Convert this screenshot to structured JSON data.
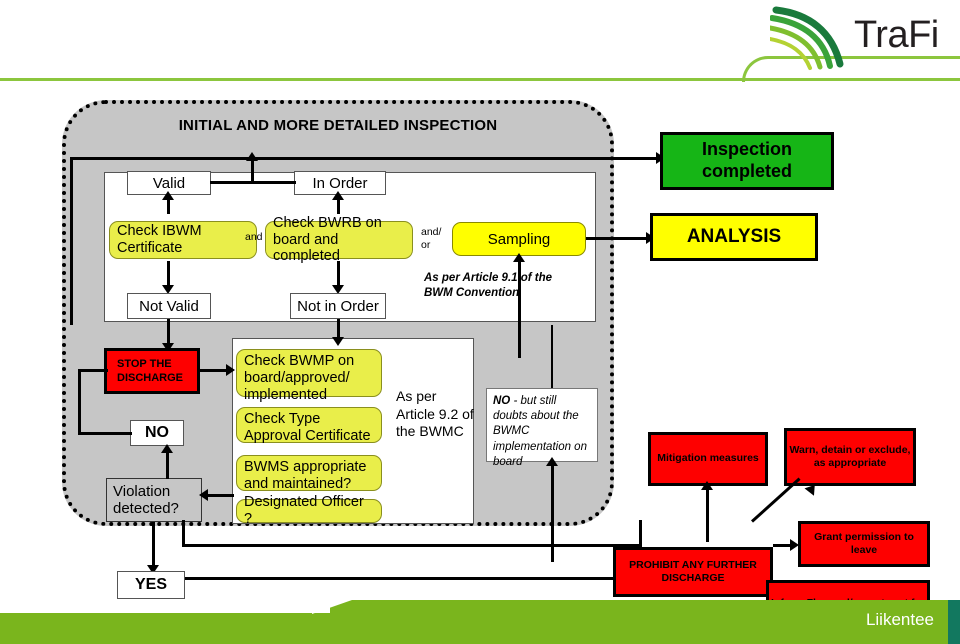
{
  "brand": {
    "logo_text": "TraFi",
    "logo_icon": "trafi-swoosh-logo",
    "accent_green": "#8cc63e",
    "accent_teal": "#12785f"
  },
  "footer": {
    "text": "Liikentee",
    "band_color": "#7ab51d"
  },
  "zone": {
    "title": "INITIAL AND MORE DETAILED INSPECTION",
    "fill": "#c6c6c6"
  },
  "top_flow": {
    "valid": "Valid",
    "in_order": "In Order",
    "not_valid_prefix": "Not ",
    "not_valid": "Not Valid",
    "not_in_order": "Not in Order",
    "check_ibwm": "Check IBWM Certificate",
    "check_bwrb": "Check BWRB on board and completed",
    "sampling": "Sampling",
    "conn_and": "and",
    "conn_and_or_line1": "and/",
    "conn_and_or_line2": "or",
    "article_note": "As per Article 9.1 of the BWM Convention"
  },
  "outcomes": {
    "inspection_completed": "Inspection completed",
    "analysis": "ANALYSIS"
  },
  "lower_flow": {
    "stop_discharge": "STOP THE DISCHARGE",
    "no": "NO",
    "yes": "YES",
    "violation_detected": "Violation detected?",
    "check_bwmp": "Check BWMP on board/approved/ implemented",
    "check_type_approval": "Check Type Approval Certificate",
    "bwms_maintained": "BWMS appropriate and maintained?",
    "designated_officer": "Designated  Officer ?",
    "article_note": "As per Article 9.2 of the BWMC",
    "doubts_note_bold": "NO",
    "doubts_note_rest": " - but still doubts about  the BWMC implementation on board"
  },
  "actions": {
    "mitigation": "Mitigation measures",
    "warn_detain": "Warn, detain or exclude, as appropriate",
    "prohibit": "PROHIBIT ANY FURTHER DISCHARGE",
    "grant_permission": "Grant permission to leave",
    "inform_flag": "Inform Flag and/ornext port for appropriate measures"
  },
  "colors": {
    "chk_yellow_green": "#e9ee4a",
    "pure_yellow": "#ffff00",
    "green": "#16b516",
    "red": "#fe0000"
  }
}
